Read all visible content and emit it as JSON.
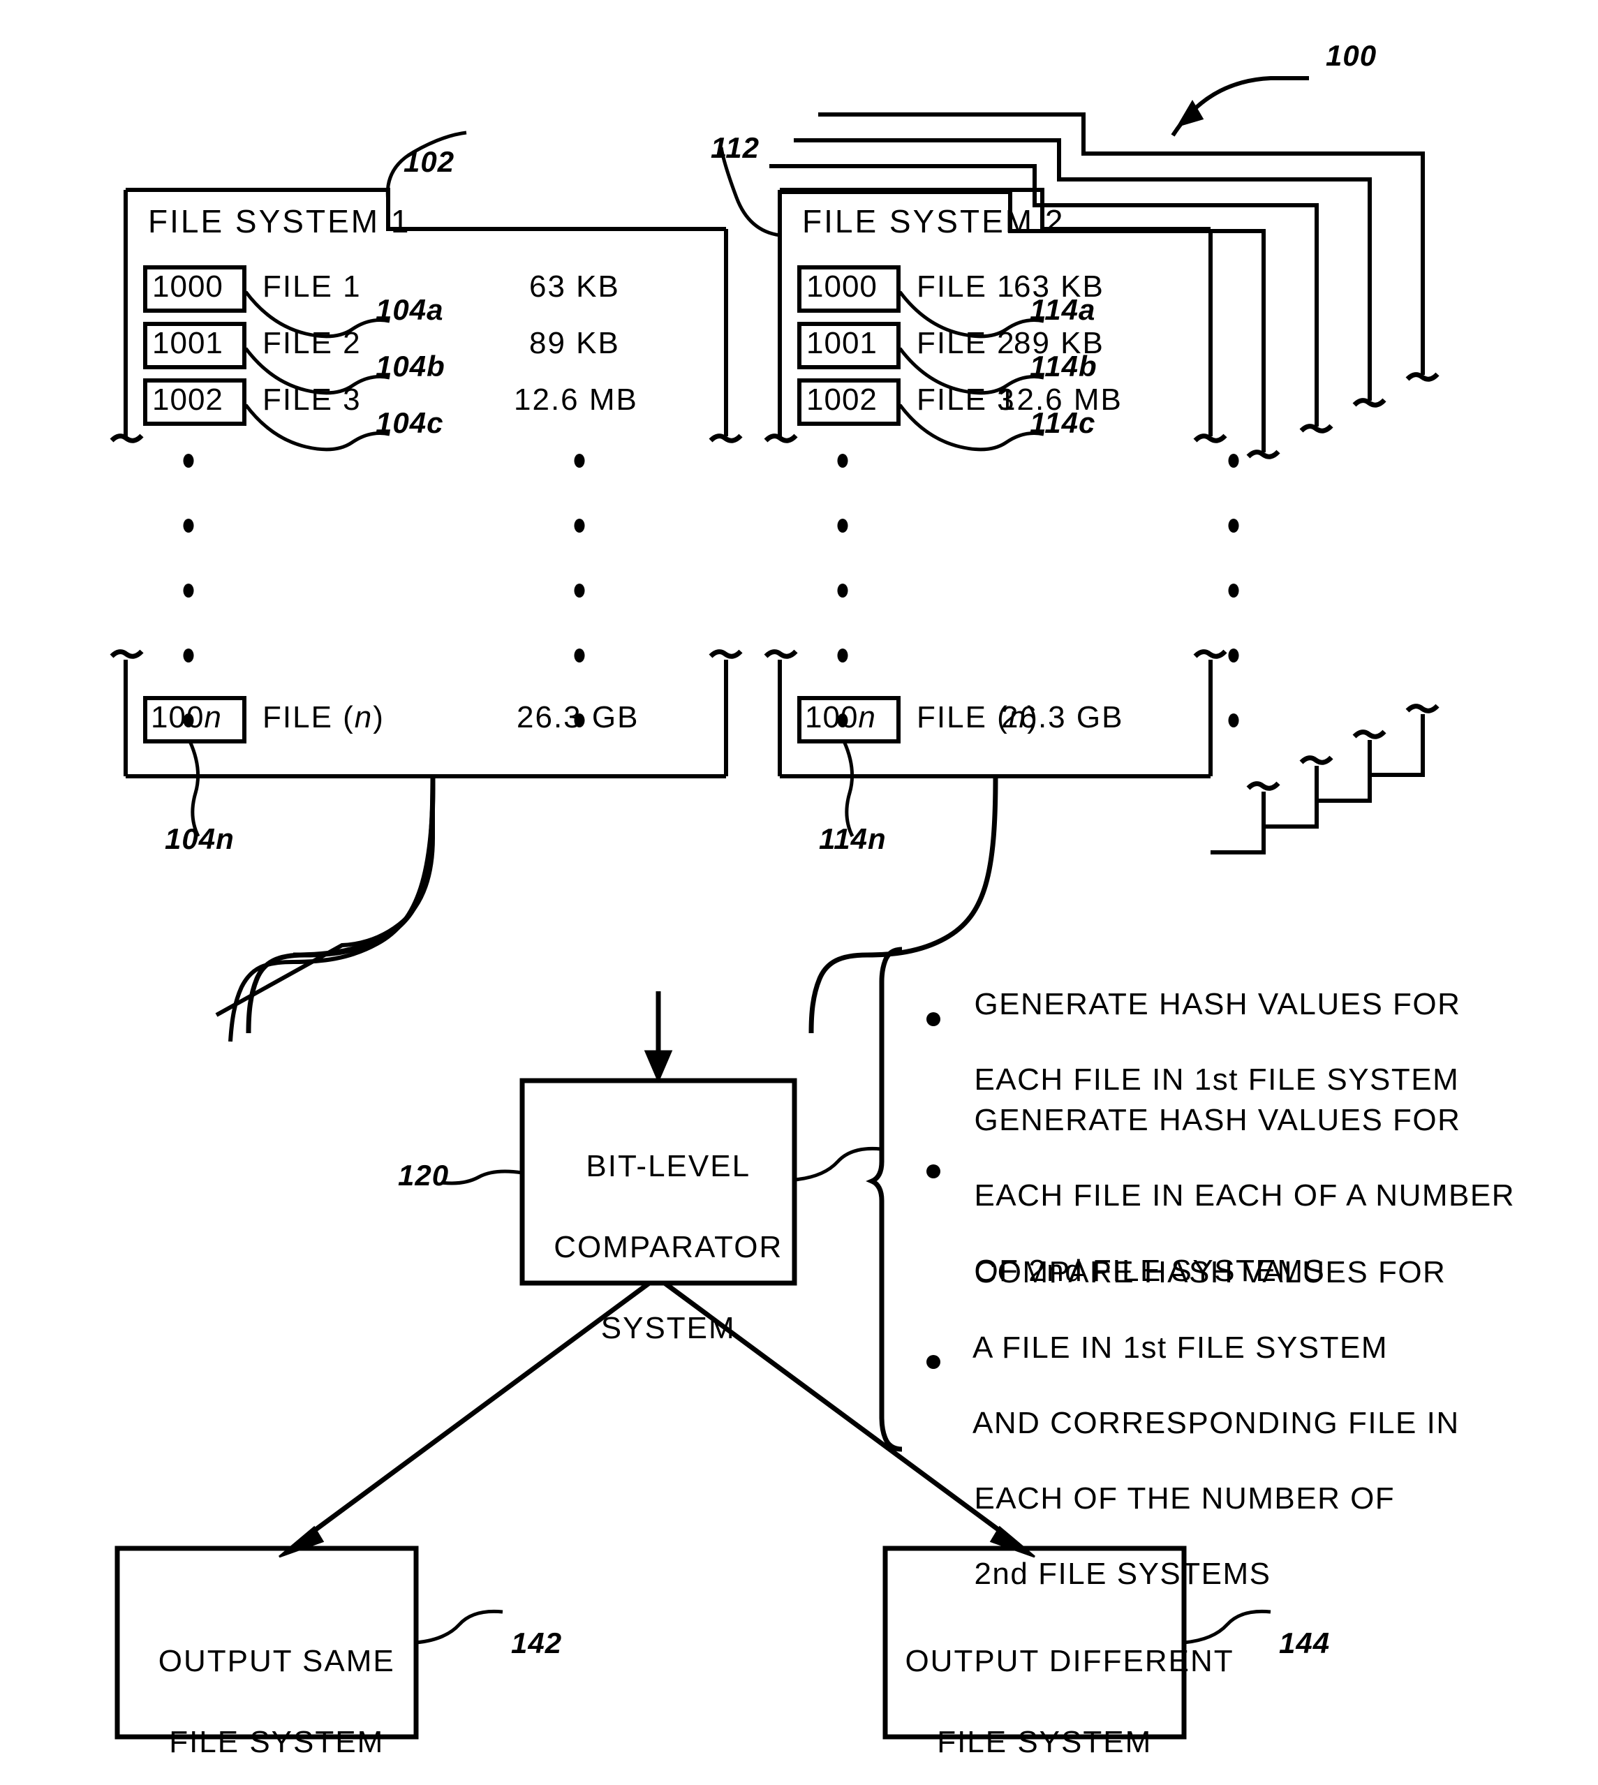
{
  "figure": {
    "ref_main": "100",
    "fs1": {
      "ref": "102",
      "title": "FILE SYSTEM 1",
      "rows": [
        {
          "inode": "1000",
          "name": "FILE 1",
          "size": "63 KB",
          "ref": "104a"
        },
        {
          "inode": "1001",
          "name": "FILE 2",
          "size": "89 KB",
          "ref": "104b"
        },
        {
          "inode": "1002",
          "name": "FILE 3",
          "size": "12.6 MB",
          "ref": "104c"
        }
      ],
      "last_row": {
        "inode_prefix": "100",
        "inode_suffix": "n",
        "name_prefix": "FILE (",
        "name_suffix": "n",
        "name_close": ")",
        "size": "26.3 GB",
        "ref": "104n"
      }
    },
    "fs2": {
      "ref": "112",
      "title": "FILE SYSTEM 2",
      "rows": [
        {
          "inode": "1000",
          "name": "FILE 1",
          "size": "63 KB",
          "ref": "114a"
        },
        {
          "inode": "1001",
          "name": "FILE 2",
          "size": "89 KB",
          "ref": "114b"
        },
        {
          "inode": "1002",
          "name": "FILE 3",
          "size": "12.6 MB",
          "ref": "114c"
        }
      ],
      "last_row": {
        "inode_prefix": "100",
        "inode_suffix": "n",
        "name_prefix": "FILE (",
        "name_suffix": "n",
        "name_close": ")",
        "size": "26.3 GB",
        "ref": "114n"
      }
    },
    "comparator": {
      "ref": "120",
      "line1": "BIT-LEVEL",
      "line2": "COMPARATOR",
      "line3": "SYSTEM"
    },
    "notes": [
      {
        "lines": [
          "GENERATE HASH VALUES FOR",
          "EACH FILE IN 1st FILE SYSTEM"
        ]
      },
      {
        "lines": [
          "GENERATE HASH VALUES FOR",
          "EACH FILE IN EACH OF A NUMBER",
          "OF 2nd FILE SYSTEMS"
        ]
      },
      {
        "lines": [
          "COMPARE HASH VALUES FOR",
          "A FILE IN 1st FILE SYSTEM",
          "AND CORRESPONDING FILE IN",
          "EACH OF THE NUMBER OF",
          "2nd FILE SYSTEMS"
        ]
      }
    ],
    "output_same": {
      "ref": "142",
      "line1": "OUTPUT SAME",
      "line2": "FILE SYSTEM"
    },
    "output_diff": {
      "ref": "144",
      "line1": "OUTPUT DIFFERENT",
      "line2": "FILE SYSTEM"
    },
    "colors": {
      "ink": "#000000",
      "paper": "#ffffff"
    }
  }
}
